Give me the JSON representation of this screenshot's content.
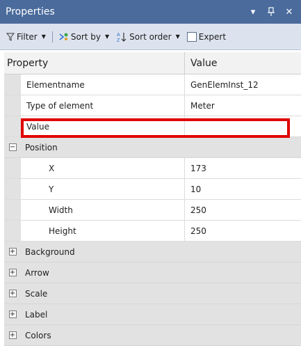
{
  "panel": {
    "title": "Properties",
    "pin_icon": "pin-icon",
    "close_icon": "close-icon"
  },
  "toolbar": {
    "filter_label": "Filter",
    "sortby_label": "Sort by",
    "sortorder_label": "Sort order",
    "expert_label": "Expert"
  },
  "grid": {
    "header_property": "Property",
    "header_value": "Value",
    "rows": [
      {
        "name": "Elementname",
        "value": "GenElemInst_12"
      },
      {
        "name": "Type of element",
        "value": "Meter"
      },
      {
        "name": "Value",
        "value": ""
      }
    ],
    "position_group": {
      "label": "Position",
      "rows": [
        {
          "name": "X",
          "value": "173"
        },
        {
          "name": "Y",
          "value": "10"
        },
        {
          "name": "Width",
          "value": "250"
        },
        {
          "name": "Height",
          "value": "250"
        }
      ]
    },
    "collapsed_groups": [
      "Background",
      "Arrow",
      "Scale",
      "Label",
      "Colors"
    ]
  },
  "colors": {
    "title_bar": "#4a6b9c",
    "highlight": "#e00000",
    "group_bg": "#e2e2e2"
  }
}
